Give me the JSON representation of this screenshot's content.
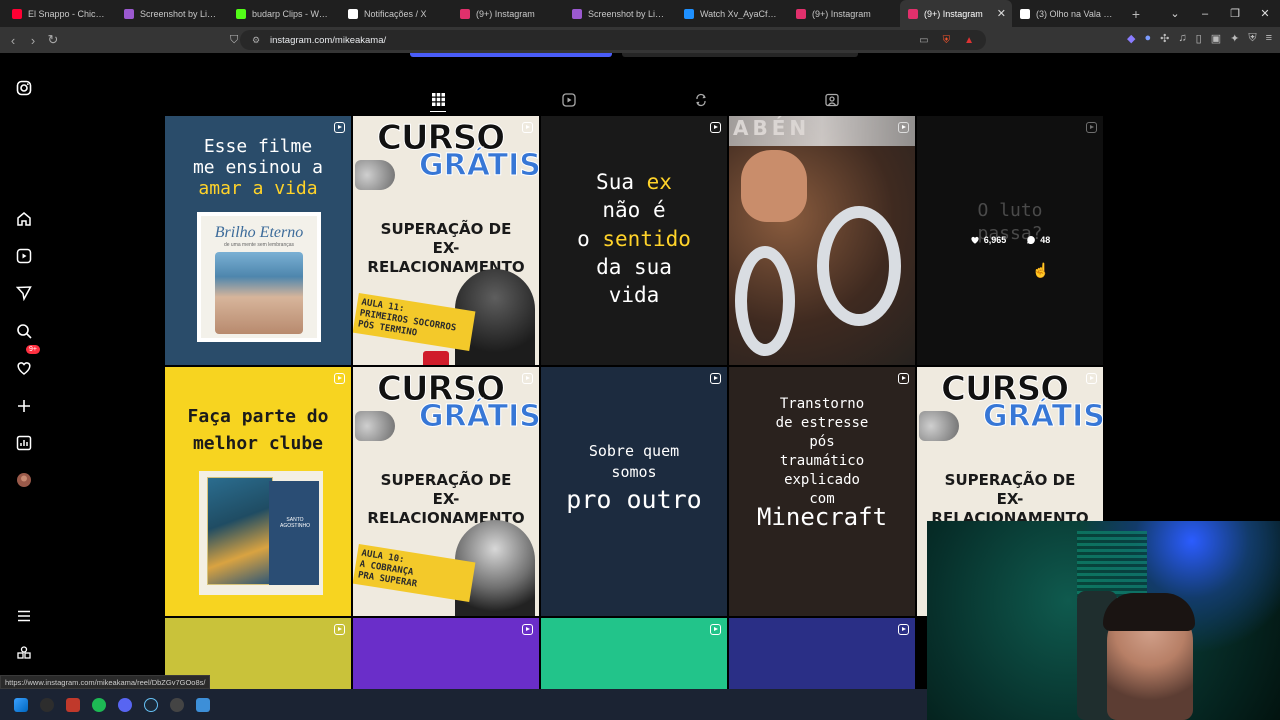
{
  "browser": {
    "tabs": [
      {
        "label": "El Snappo - Chicken [I",
        "color": "#ff0033"
      },
      {
        "label": "Screenshot by Lightsh",
        "color": "#9b59d0"
      },
      {
        "label": "budarp Clips - Watch",
        "color": "#53fc18"
      },
      {
        "label": "Notificações / X",
        "color": "#ffffff"
      },
      {
        "label": "(9+) Instagram",
        "color": "#e1306c"
      },
      {
        "label": "Screenshot by Lightsh",
        "color": "#9b59d0"
      },
      {
        "label": "Watch Xv_AyaCfyhSfg",
        "color": "#1e90ff"
      },
      {
        "label": "(9+) Instagram",
        "color": "#e1306c"
      },
      {
        "label": "(9+) Instagram",
        "color": "#e1306c",
        "active": true
      },
      {
        "label": "(3) Olho na Vala no X",
        "color": "#ffffff"
      }
    ],
    "url": "instagram.com/mikeakama/",
    "status_url": "https://www.instagram.com/mikeakama/reel/DbZGv7GOo8s/"
  },
  "sidebar": {
    "notification_badge": "9+"
  },
  "grid": {
    "row1": {
      "t1": {
        "l1": "Esse filme",
        "l2": "me ensinou a",
        "l3": "amar a vida",
        "poster_title": "Brilho Eterno",
        "poster_sub": "de uma mente sem lembranças"
      },
      "t2": {
        "c1": "CURSO",
        "c2": "GRÁTIS",
        "h1": "SUPERAÇÃO DE",
        "h2": "EX-",
        "h3": "RELACIONAMENTO",
        "aula1": "AULA 11:",
        "aula2": "PRIMEIROS SOCORROS",
        "aula3": "PÓS TERMINO"
      },
      "t3": {
        "l1": "Sua",
        "l1b": "ex",
        "l2": "não é",
        "l3": "o",
        "l3b": "sentido",
        "l4": "da sua",
        "l5": "vida"
      },
      "t4": {
        "banner": "ABÉN"
      },
      "t5": {
        "l1": "O luto",
        "l2": "passa?",
        "likes": "6,965",
        "comments": "48"
      }
    },
    "row2": {
      "t6": {
        "l1": "Faça parte do",
        "l2": "melhor clube",
        "book": "SANTO AGOSTINHO"
      },
      "t7": {
        "c1": "CURSO",
        "c2": "GRÁTIS",
        "h1": "SUPERAÇÃO DE",
        "h2": "EX-",
        "h3": "RELACIONAMENTO",
        "aula1": "AULA 10:",
        "aula2": "A COBRANÇA",
        "aula3": "PRA SUPERAR"
      },
      "t8": {
        "l1": "Sobre quem",
        "l2": "somos",
        "l3": "pro outro"
      },
      "t9": {
        "l1": "Transtorno",
        "l2": "de estresse",
        "l3": "pós",
        "l4": "traumático",
        "l5": "explicado",
        "l6": "com",
        "l7": "Minecraft"
      },
      "t10": {
        "c1": "CURSO",
        "c2": "GRÁTIS",
        "h1": "SUPERAÇÃO DE",
        "h2": "EX-",
        "h3": "RELACIONAMENTO"
      }
    },
    "row3_colors": [
      "#c9c23a",
      "#6a2ec9",
      "#22c48a",
      "#2a2f86"
    ]
  }
}
